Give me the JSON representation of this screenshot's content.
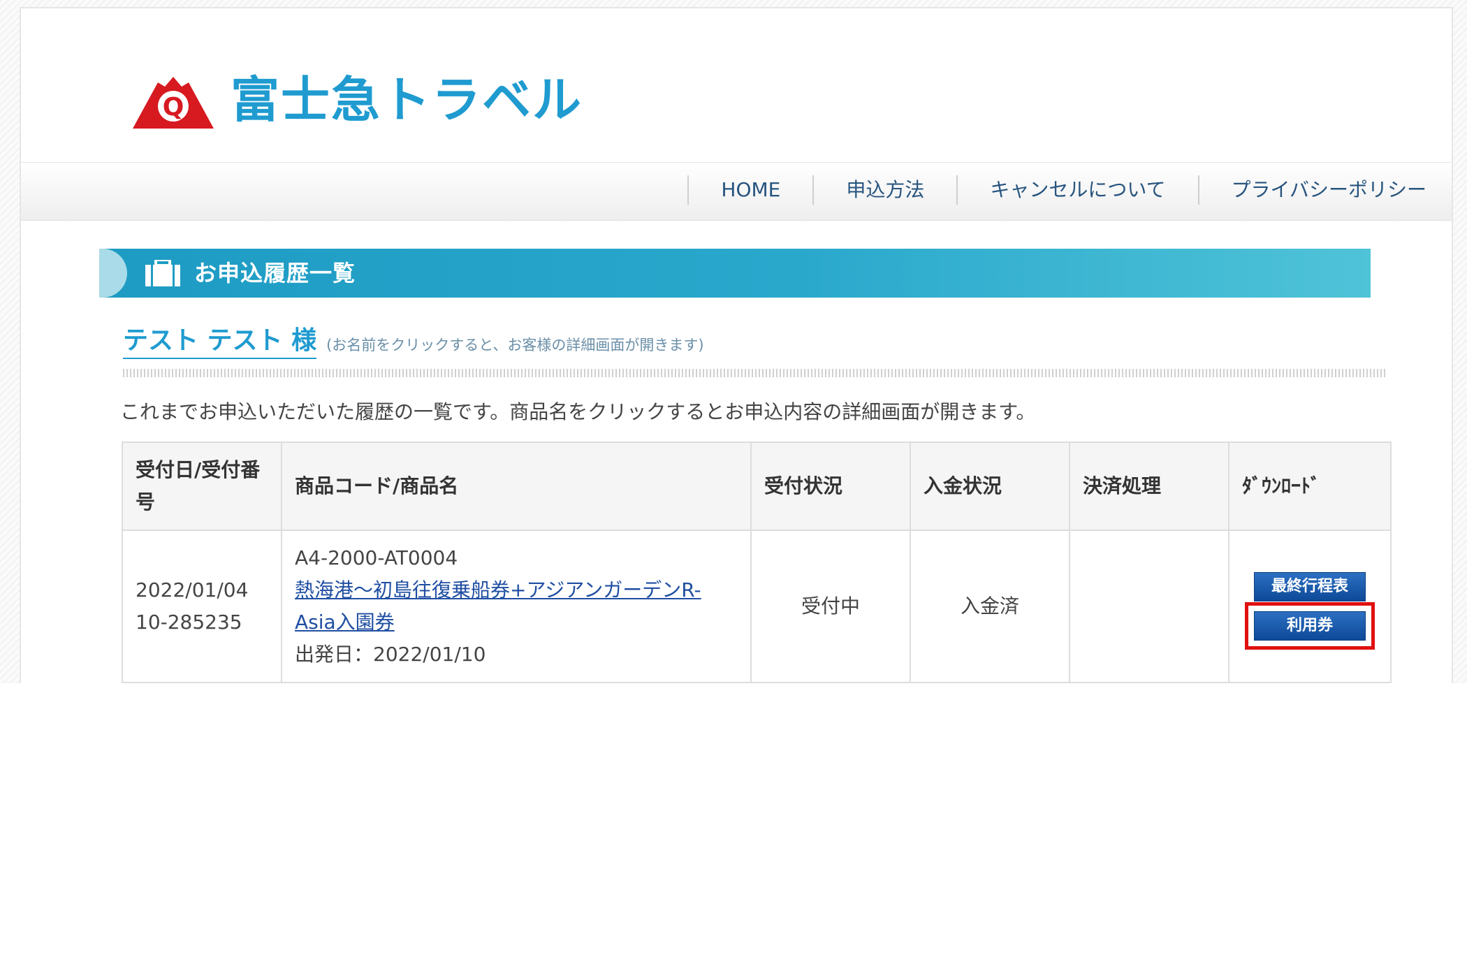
{
  "brand": {
    "name": "富士急トラベル",
    "logo_letter": "Q"
  },
  "nav": {
    "items": [
      {
        "label": "HOME"
      },
      {
        "label": "申込方法"
      },
      {
        "label": "キャンセルについて"
      },
      {
        "label": "プライバシーポリシー"
      }
    ]
  },
  "section": {
    "title": "お申込履歴一覧"
  },
  "user": {
    "name": "テスト テスト 様",
    "hint": "(お名前をクリックすると、お客様の詳細画面が開きます)"
  },
  "intro_text": "これまでお申込いただいた履歴の一覧です。商品名をクリックするとお申込内容の詳細画面が開きます。",
  "table": {
    "headers": {
      "date_no": "受付日/受付番号",
      "product": "商品コード/商品名",
      "status": "受付状況",
      "payment": "入金状況",
      "settlement": "決済処理",
      "download": "ﾀﾞｳﾝﾛｰﾄﾞ"
    },
    "rows": [
      {
        "date": "2022/01/04",
        "number": "10-285235",
        "code": "A4-2000-AT0004",
        "product_name": "熱海港～初島往復乗船券+アジアンガーデンR-Asia入園券",
        "departure": "出発日：2022/01/10",
        "status": "受付中",
        "payment": "入金済",
        "settlement": "",
        "buttons": {
          "itinerary": "最終行程表",
          "voucher": "利用券"
        }
      }
    ]
  },
  "colors": {
    "brand_blue": "#1f9bd0",
    "header_band": "#2aa8cc",
    "button_blue": "#0d4a98",
    "highlight_red": "#e01010",
    "logo_red": "#d71920"
  }
}
